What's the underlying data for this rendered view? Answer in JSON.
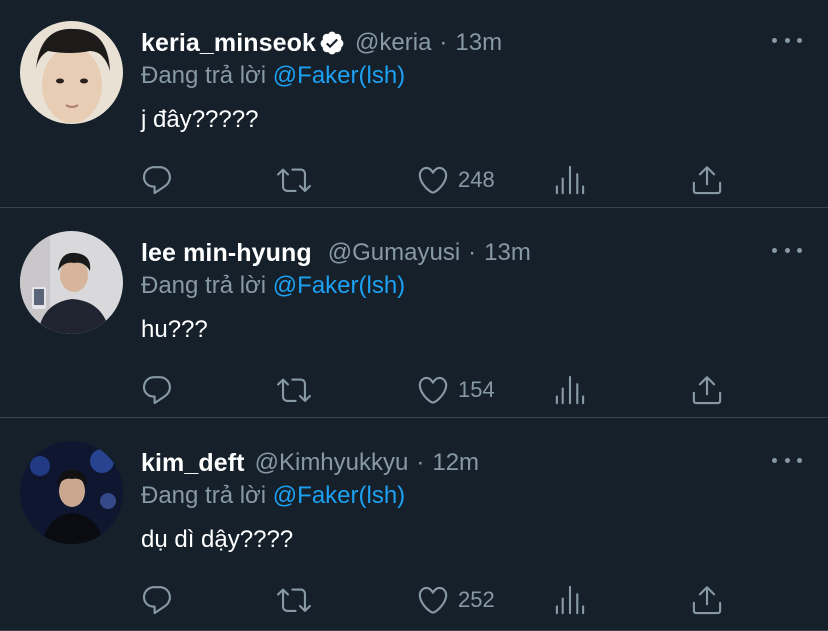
{
  "tweets": [
    {
      "display_name": "keria_minseok",
      "verified": true,
      "handle": "@keria",
      "time": "13m",
      "reply_prefix": "Đang trả lời",
      "reply_to": "@Faker(lsh)",
      "text": "j đây?????",
      "likes": "248"
    },
    {
      "display_name": "lee min-hyung",
      "verified": false,
      "handle": "@Gumayusi",
      "time": "13m",
      "reply_prefix": "Đang trả lời",
      "reply_to": "@Faker(lsh)",
      "text": "hu???",
      "likes": "154"
    },
    {
      "display_name": "kim_deft",
      "verified": false,
      "handle": "@Kimhyukkyu",
      "time": "12m",
      "reply_prefix": "Đang trả lời",
      "reply_to": "@Faker(lsh)",
      "text": "dụ dì dậy????",
      "likes": "252"
    }
  ],
  "separator": "·",
  "icons": {
    "reply": "reply-icon",
    "retweet": "retweet-icon",
    "like": "heart-icon",
    "analytics": "analytics-icon",
    "share": "share-icon",
    "more": "more-icon",
    "verified": "verified-badge-icon"
  },
  "colors": {
    "background": "#15202b",
    "secondary_text": "#8899a6",
    "link": "#1da1f2",
    "divider": "#38444d"
  }
}
